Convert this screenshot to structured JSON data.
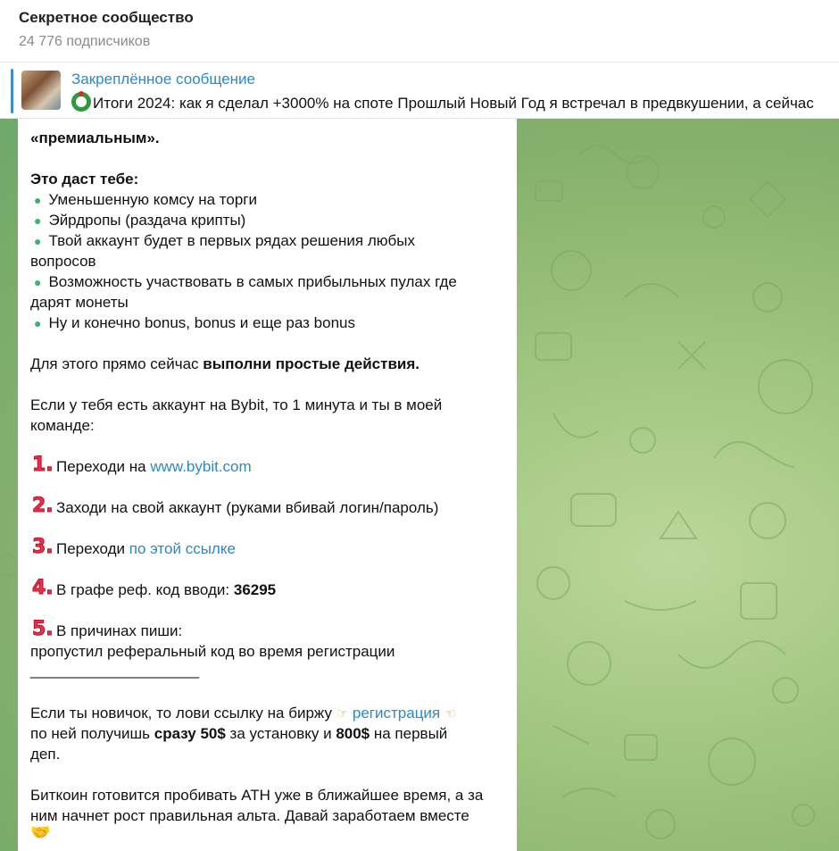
{
  "header": {
    "title": "Секретное сообщество",
    "subscribers": "24 776 подписчиков"
  },
  "pinned": {
    "title": "Закреплённое сообщение",
    "text": "Итоги 2024: как я сделал +3000% на споте  Прошлый Новый Год я встречал в предвкушении, а сейчас"
  },
  "message": {
    "premium": "«премиальным».",
    "benefits_title": "Это даст тебе:",
    "benefit_1": "Уменьшенную комсу на торги",
    "benefit_2": "Эйрдропы (раздача крипты)",
    "benefit_3_a": "Твой аккаунт будет в первых рядах решения любых",
    "benefit_3_b": "вопросов",
    "benefit_4_a": "Возможность участвовать в самых прибыльных пулах где",
    "benefit_4_b": "дарят монеты",
    "benefit_5": "Ну и конечно bonus, bonus и еще раз bonus",
    "action_prefix": "Для этого прямо сейчас ",
    "action_bold": "выполни простые действия.",
    "bybit_a": "Если у тебя есть аккаунт на Bybit, то 1 минута и ты в моей",
    "bybit_b": "команде:",
    "step1_num": "1.",
    "step1_text": "Переходи на ",
    "step1_link": "www.bybit.com",
    "step2_num": "2.",
    "step2_text": "Заходи на свой аккаунт (руками вбивай логин/пароль)",
    "step3_num": "3.",
    "step3_text": "Переходи ",
    "step3_link": "по этой ссылке",
    "step4_num": "4.",
    "step4_text": "В графе реф. код вводи: ",
    "step4_code": "36295",
    "step5_num": "5.",
    "step5_text": "В причинах пиши:",
    "step5_reason": "пропустил реферальный код во время регистрации",
    "divider": "____________________",
    "newbie_a": "Если ты новичок, то лови ссылку на биржу ",
    "newbie_link": "регистрация",
    "newbie_b1": "по ней получишь ",
    "newbie_b2": "сразу 50$",
    "newbie_b3": " за установку и ",
    "newbie_b4": "800$",
    "newbie_b5": " на первый",
    "newbie_c": "деп.",
    "btc_a": "Биткоин готовится пробивать АТН уже в ближайшее время, а за",
    "btc_b": "ним начнет рост правильная альта. Давай заработаем вместе"
  }
}
